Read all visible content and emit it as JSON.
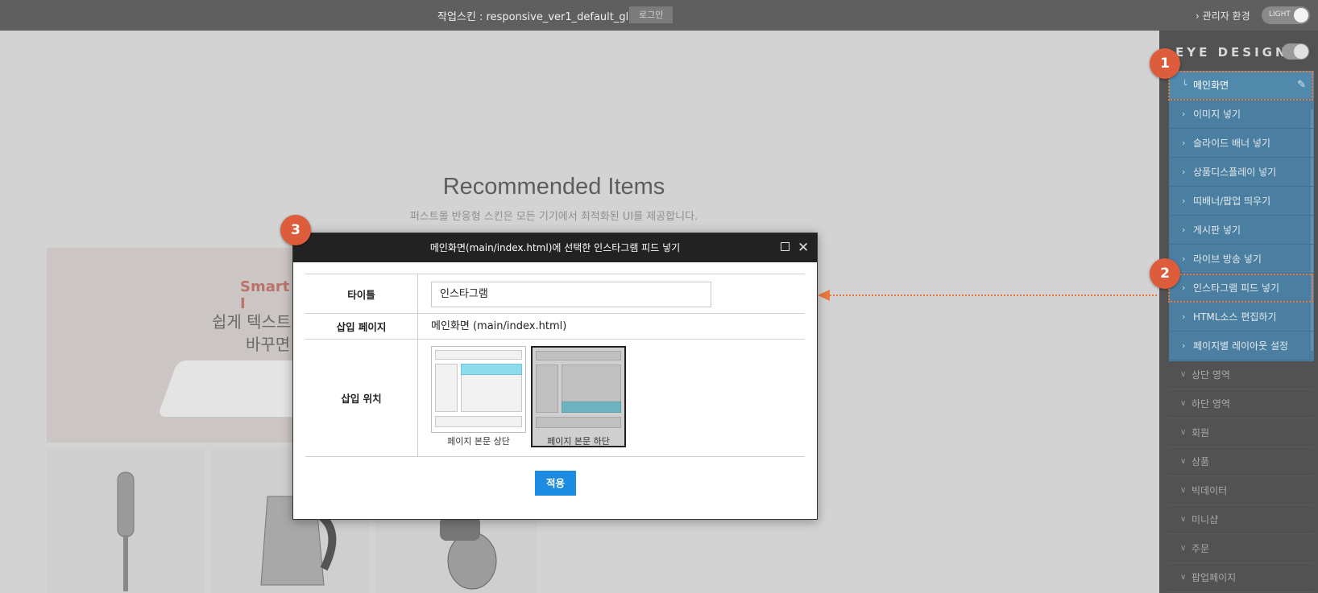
{
  "topbar": {
    "skin_label": "작업스킨 : responsive_ver1_default_gl",
    "login_button": "로그인",
    "admin_env_link": "› 관리자 환경",
    "theme_toggle": "LIGHT"
  },
  "page": {
    "section_title": "Recommended Items",
    "section_subtitle": "퍼스트몰 반응형 스킨은 모든 기기에서 최적화된 UI를 제공합니다.",
    "banner_heading": "Smart I",
    "banner_line1": "쉽게 텍스트",
    "banner_line2": "바꾸면"
  },
  "sidebar": {
    "title": "EYE DESIGN",
    "menu_items": [
      {
        "label": "메인화면",
        "icon": "corner-arrow-icon"
      },
      {
        "label": "이미지 넣기",
        "icon": "chevron-right-icon"
      },
      {
        "label": "슬라이드 배너 넣기",
        "icon": "chevron-right-icon"
      },
      {
        "label": "상품디스플레이 넣기",
        "icon": "chevron-right-icon"
      },
      {
        "label": "띠배너/팝업 띄우기",
        "icon": "chevron-right-icon"
      },
      {
        "label": "게시판 넣기",
        "icon": "chevron-right-icon"
      },
      {
        "label": "라이브 방송 넣기",
        "icon": "chevron-right-icon"
      },
      {
        "label": "인스타그램 피드 넣기",
        "icon": "chevron-right-icon"
      },
      {
        "label": "HTML소스 편집하기",
        "icon": "chevron-right-icon"
      },
      {
        "label": "페이지별 레이아웃 설정",
        "icon": "chevron-right-icon"
      }
    ],
    "sections": [
      {
        "label": "상단 영역"
      },
      {
        "label": "하단 영역"
      },
      {
        "label": "회원"
      },
      {
        "label": "상품"
      },
      {
        "label": "빅데이터"
      },
      {
        "label": "미니샵"
      },
      {
        "label": "주문"
      },
      {
        "label": "팝업페이지"
      }
    ]
  },
  "badges": {
    "one": "1",
    "two": "2",
    "three": "3"
  },
  "dialog": {
    "title": "메인화면(main/index.html)에 선택한 인스타그램 피드 넣기",
    "title_label": "타이틀",
    "title_value": "인스타그램",
    "page_label": "삽입 페이지",
    "page_value": "메인화면 (main/index.html)",
    "position_label": "삽입 위치",
    "position_options": [
      {
        "label": "페이지 본문 상단",
        "selected": false
      },
      {
        "label": "페이지 본문 하단",
        "selected": true
      }
    ],
    "apply_button": "적용"
  },
  "colors": {
    "accent_orange": "#dd5c3b",
    "apply_blue": "#1c8ce3",
    "menu_blue": "#4b7fa1"
  }
}
